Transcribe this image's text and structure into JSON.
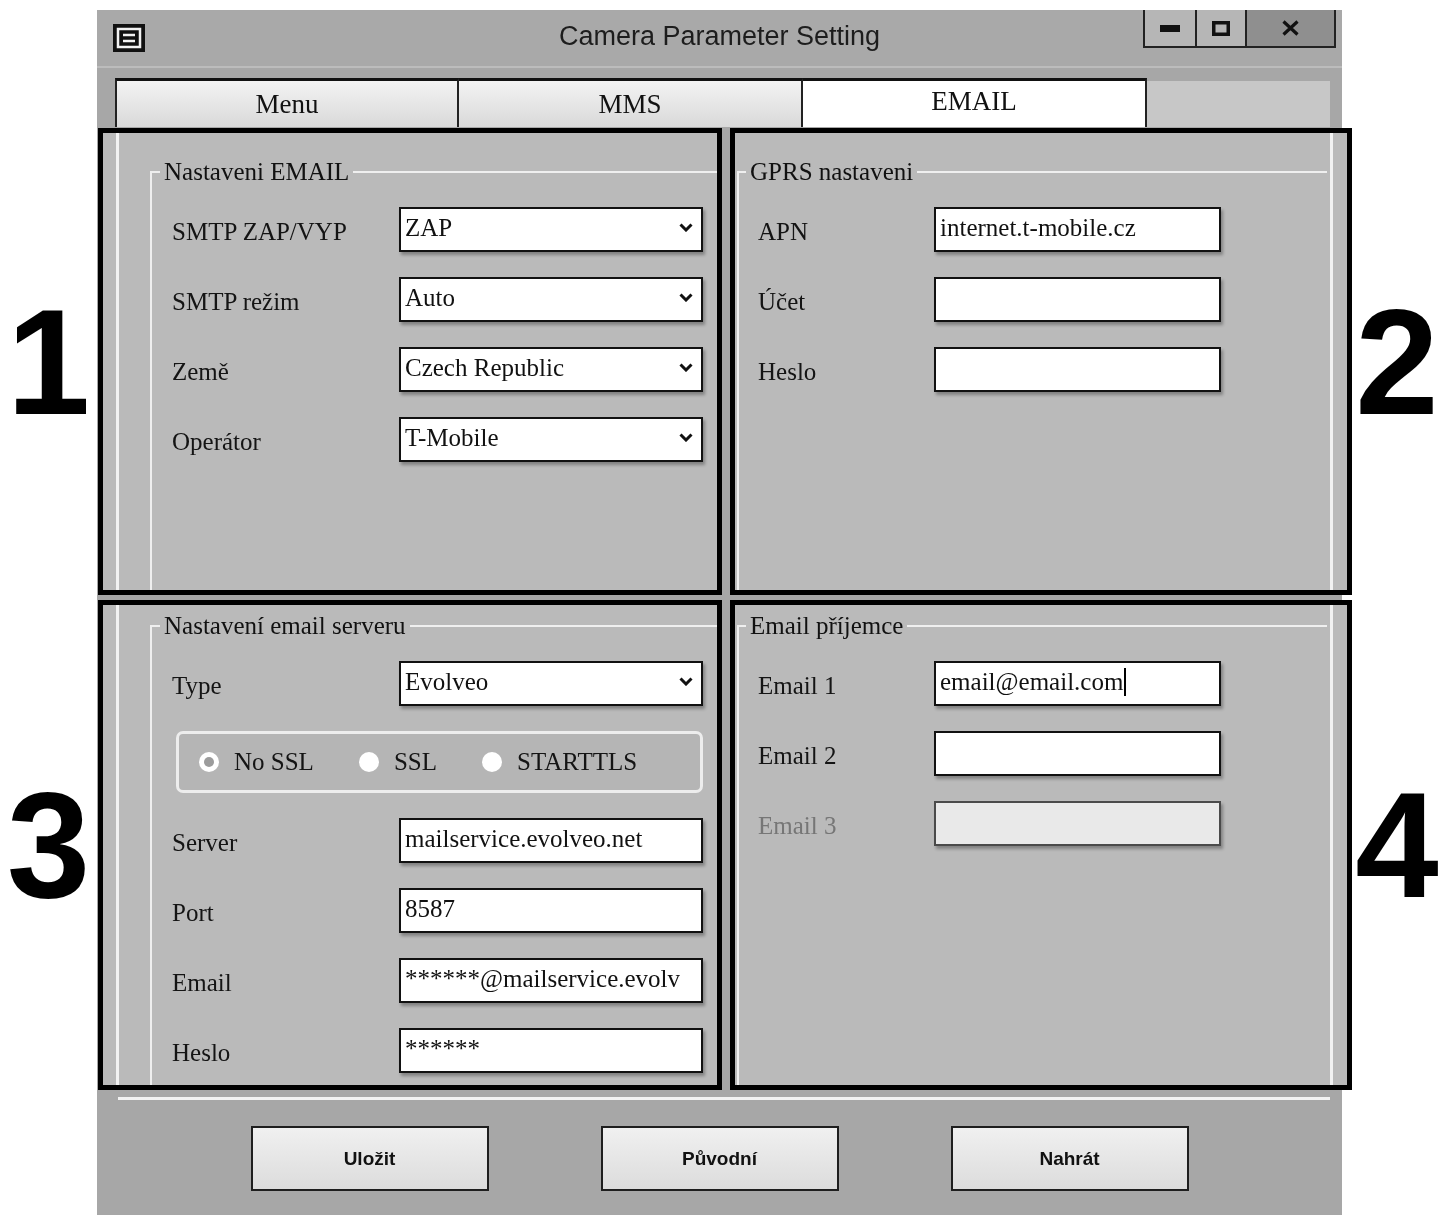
{
  "window": {
    "title": "Camera Parameter Setting"
  },
  "tabs": [
    {
      "label": "Menu",
      "selected": false
    },
    {
      "label": "MMS",
      "selected": false
    },
    {
      "label": "EMAIL",
      "selected": true
    }
  ],
  "sections": [
    {
      "number": "1",
      "title": "Nastaveni EMAIL",
      "fields": [
        {
          "kind": "select",
          "label": "SMTP ZAP/VYP",
          "value": "ZAP",
          "disabled": false,
          "focused": false
        },
        {
          "kind": "select",
          "label": "SMTP režim",
          "value": "Auto",
          "disabled": false,
          "focused": false
        },
        {
          "kind": "select",
          "label": "Země",
          "value": "Czech Republic",
          "disabled": false,
          "focused": false
        },
        {
          "kind": "select",
          "label": "Operátor",
          "value": "T-Mobile",
          "disabled": false,
          "focused": false
        }
      ]
    },
    {
      "number": "2",
      "title": "GPRS nastaveni",
      "fields": [
        {
          "kind": "text",
          "label": "APN",
          "value": "internet.t-mobile.cz",
          "disabled": false,
          "focused": false
        },
        {
          "kind": "text",
          "label": "Účet",
          "disabled": false,
          "focused": false
        },
        {
          "kind": "text",
          "label": "Heslo",
          "disabled": false,
          "focused": false
        }
      ]
    },
    {
      "number": "3",
      "title": "Nastavení email serveru",
      "fields": [
        {
          "kind": "select",
          "label": "Type",
          "value": "Evolveo",
          "disabled": false,
          "focused": false
        },
        {
          "kind": "radio_group",
          "disabled": false,
          "options": [
            {
              "label": "No SSL",
              "selected": true
            },
            {
              "label": "SSL",
              "selected": false
            },
            {
              "label": "STARTTLS",
              "selected": false
            }
          ]
        },
        {
          "kind": "text",
          "label": "Server",
          "value": "mailservice.evolveo.net",
          "disabled": false,
          "focused": false
        },
        {
          "kind": "text",
          "label": "Port",
          "value": "8587",
          "disabled": false,
          "focused": false
        },
        {
          "kind": "text",
          "label": "Email",
          "value": "******@mailservice.evolv",
          "disabled": false,
          "focused": false
        },
        {
          "kind": "text",
          "label": "Heslo",
          "value": "******",
          "disabled": false,
          "focused": false
        }
      ]
    },
    {
      "number": "4",
      "title": "Email příjemce",
      "fields": [
        {
          "kind": "text",
          "label": "Email 1",
          "value": "email@email.com",
          "disabled": false,
          "focused": true
        },
        {
          "kind": "text",
          "label": "Email 2",
          "disabled": false,
          "focused": false
        },
        {
          "kind": "text",
          "label": "Email 3",
          "disabled": true,
          "focused": false
        }
      ]
    }
  ],
  "buttons": [
    "Uložit",
    "Původní",
    "Nahrát"
  ]
}
